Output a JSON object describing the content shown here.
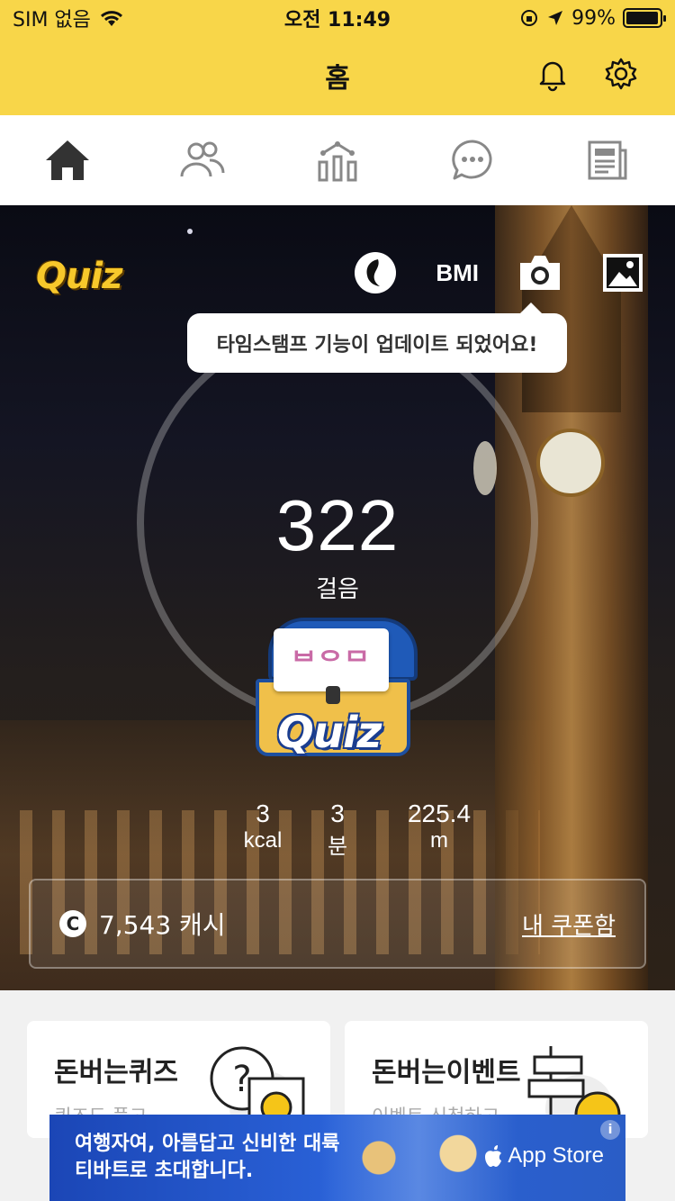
{
  "status_bar": {
    "carrier": "SIM 없음",
    "time": "오전 11:49",
    "battery": "99%",
    "battery_level": 0.99
  },
  "header": {
    "title": "홈",
    "icons": [
      "bell-icon",
      "gear-icon"
    ]
  },
  "tabs": [
    {
      "icon": "home-icon",
      "active": true
    },
    {
      "icon": "people-icon",
      "active": false
    },
    {
      "icon": "chart-icon",
      "active": false
    },
    {
      "icon": "chat-icon",
      "active": false
    },
    {
      "icon": "news-icon",
      "active": false
    }
  ],
  "hero": {
    "quiz_logo": "Quiz",
    "tools": {
      "bmi_label": "BMI"
    },
    "tooltip": "타임스탬프 기능이 업데이트 되었어요!",
    "steps": "322",
    "steps_label": "걸음",
    "chest_card": "ᄇᄋᄆ",
    "chest_quiz": "Quiz",
    "stats": [
      {
        "value": "3",
        "unit": "kcal"
      },
      {
        "value": "3",
        "unit": "분"
      },
      {
        "value": "225.4",
        "unit": "m"
      }
    ],
    "cash": {
      "icon_letter": "C",
      "amount": "7,543 캐시",
      "coupon_link": "내 쿠폰함"
    }
  },
  "cards": [
    {
      "title": "돈버는퀴즈",
      "subtitle": "퀴즈도 풀고"
    },
    {
      "title": "돈버는이벤트",
      "subtitle": "이벤트 신청하고"
    }
  ],
  "ad": {
    "line1": "여행자여, 아름답고 신비한 대륙",
    "line2": "티바트로 초대합니다.",
    "store": "App Store",
    "info": "i"
  },
  "colors": {
    "brand_yellow": "#f8d649",
    "ad_blue": "#2a62d8"
  }
}
